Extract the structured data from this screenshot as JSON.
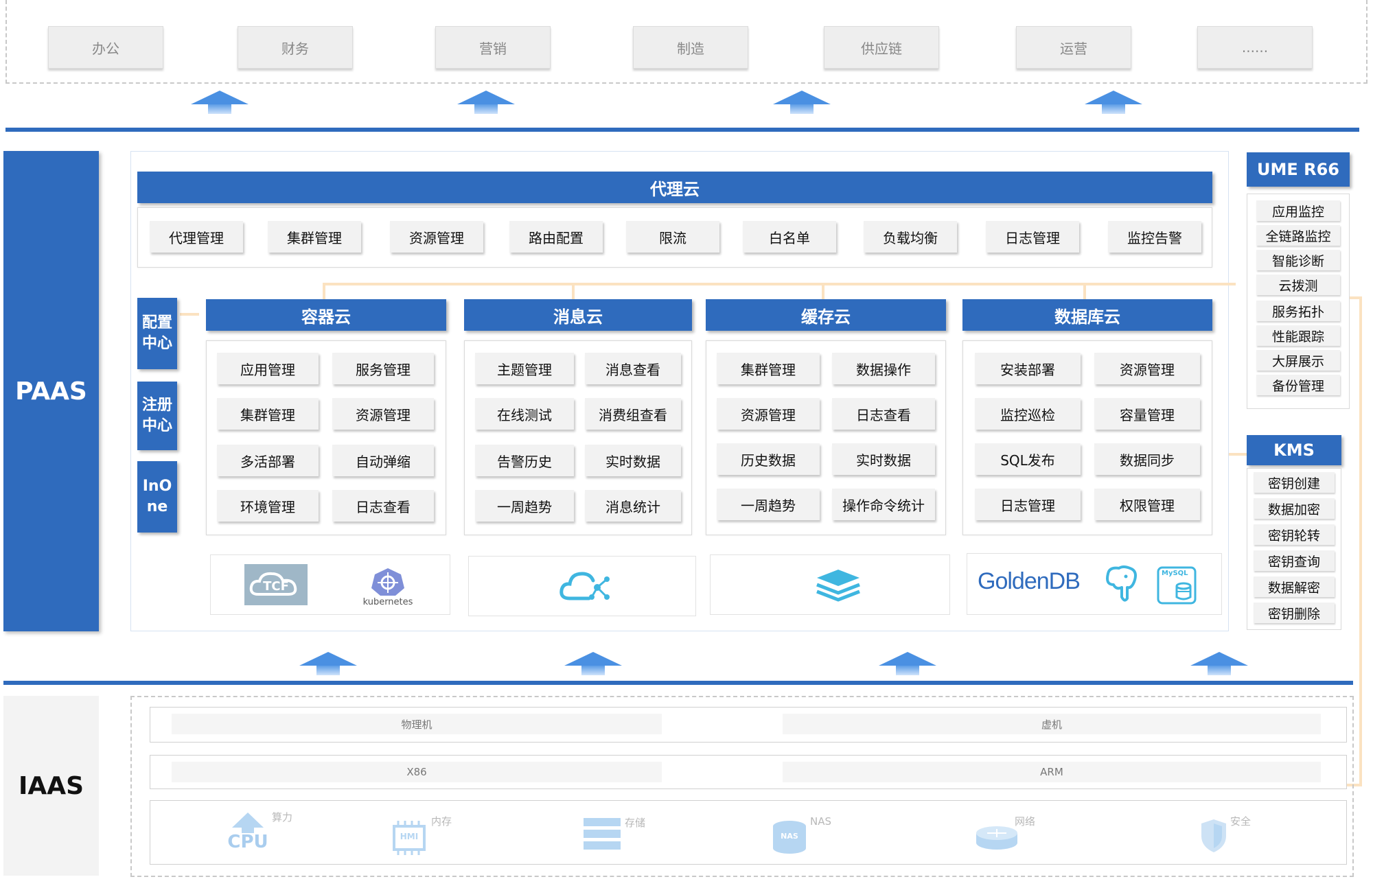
{
  "business_row": [
    "办公",
    "财务",
    "营销",
    "制造",
    "供应链",
    "运营",
    "......"
  ],
  "paas_label": "PAAS",
  "iaas_label": "IAAS",
  "proxy_cloud": {
    "title": "代理云",
    "items": [
      "代理管理",
      "集群管理",
      "资源管理",
      "路由配置",
      "限流",
      "白名单",
      "负载均衡",
      "日志管理",
      "监控告警"
    ]
  },
  "side_buttons": [
    "配置\n中心",
    "注册\n中心",
    "InO\nne"
  ],
  "clouds": [
    {
      "title": "容器云",
      "items": [
        "应用管理",
        "服务管理",
        "集群管理",
        "资源管理",
        "多活部署",
        "自动弹缩",
        "环境管理",
        "日志查看"
      ]
    },
    {
      "title": "消息云",
      "items": [
        "主题管理",
        "消息查看",
        "在线测试",
        "消费组查看",
        "告警历史",
        "实时数据",
        "一周趋势",
        "消息统计"
      ]
    },
    {
      "title": "缓存云",
      "items": [
        "集群管理",
        "数据操作",
        "资源管理",
        "日志查看",
        "历史数据",
        "实时数据",
        "一周趋势",
        "操作命令统计"
      ]
    },
    {
      "title": "数据库云",
      "items": [
        "安装部署",
        "资源管理",
        "监控巡检",
        "容量管理",
        "SQL发布",
        "数据同步",
        "日志管理",
        "权限管理"
      ]
    }
  ],
  "logos": {
    "tcf": "TCF",
    "kubernetes": "kubernetes",
    "goldendb": "GoldenDB",
    "mysql": "MySQL"
  },
  "ume": {
    "title": "UME R66",
    "items": [
      "应用监控",
      "全链路监控",
      "智能诊断",
      "云拨测",
      "服务拓扑",
      "性能跟踪",
      "大屏展示",
      "备份管理"
    ]
  },
  "kms": {
    "title": "KMS",
    "items": [
      "密钥创建",
      "数据加密",
      "密钥轮转",
      "密钥查询",
      "数据解密",
      "密钥删除"
    ]
  },
  "iaas": {
    "row1": [
      "物理机",
      "虚机"
    ],
    "row2": [
      "X86",
      "ARM"
    ],
    "resources": [
      {
        "label": "算力",
        "icon": "cpu-icon",
        "text": "CPU"
      },
      {
        "label": "内存",
        "icon": "memory-icon",
        "text": "HMI"
      },
      {
        "label": "存储",
        "icon": "storage-icon",
        "text": ""
      },
      {
        "label": "NAS",
        "icon": "nas-icon",
        "text": "NAS"
      },
      {
        "label": "网络",
        "icon": "router-icon",
        "text": ""
      },
      {
        "label": "安全",
        "icon": "shield-icon",
        "text": ""
      }
    ]
  },
  "colors": {
    "primary": "#2f6bbd",
    "connector": "#fbe2c1",
    "logo_cyan": "#3fb6e0"
  }
}
